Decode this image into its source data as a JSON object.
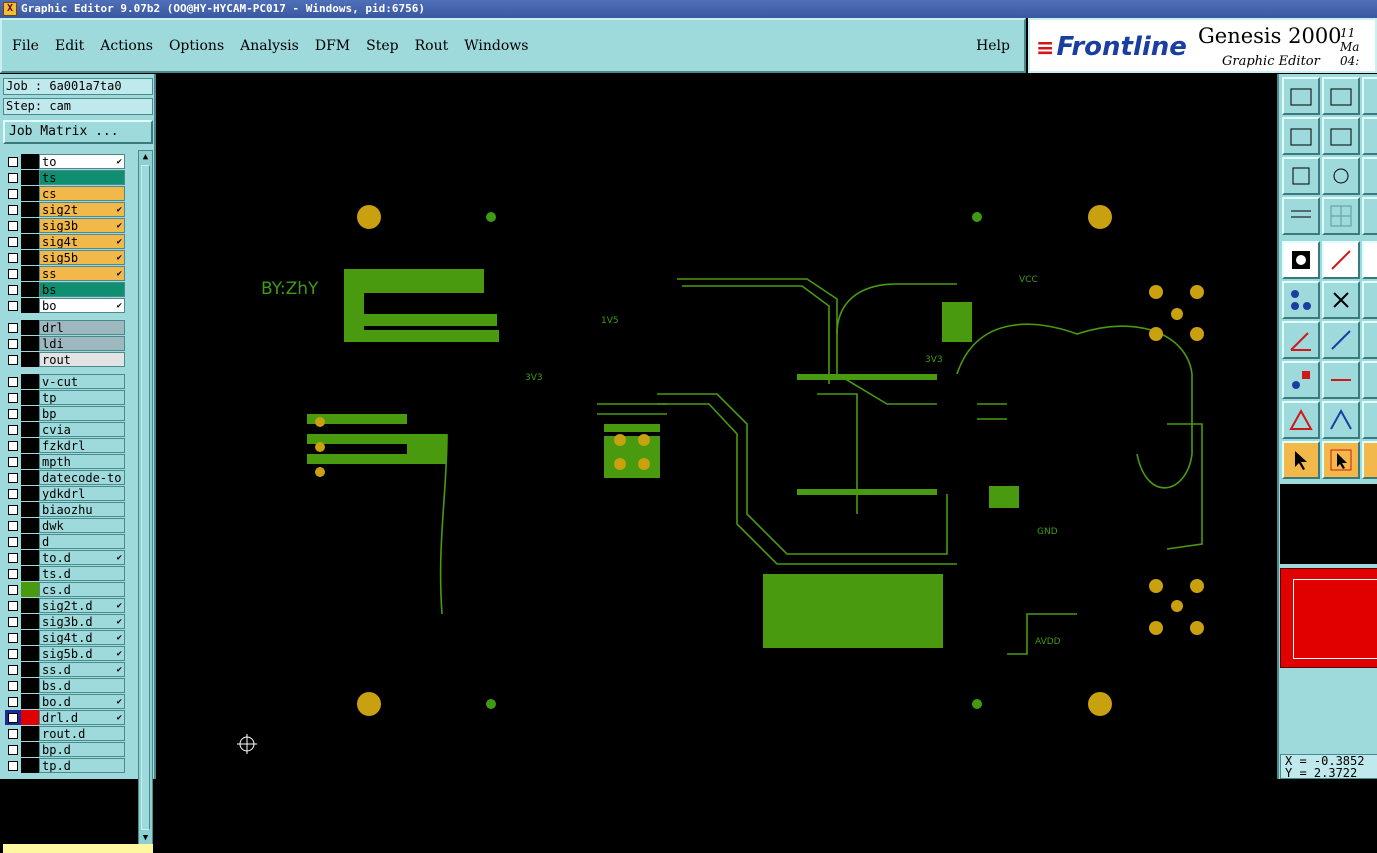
{
  "window": {
    "title": "Graphic Editor 9.07b2 (OO@HY-HYCAM-PC017 - Windows, pid:6756)"
  },
  "menu": [
    "File",
    "Edit",
    "Actions",
    "Options",
    "Analysis",
    "DFM",
    "Step",
    "Rout",
    "Windows"
  ],
  "menu_help": "Help",
  "brand": {
    "logo": "Frontline",
    "product": "Genesis 2000",
    "subtitle": "Graphic Editor",
    "clock_line1": "11 Ma",
    "clock_line2": "04:"
  },
  "job": {
    "label": "Job : 6a001a7ta0",
    "step": "Step: cam",
    "matrix_button": "Job Matrix ..."
  },
  "layers": [
    {
      "name": "to",
      "color": "#ffffff",
      "tick": true
    },
    {
      "name": "ts",
      "color": "#0e8f70",
      "tick": false
    },
    {
      "name": "cs",
      "color": "#f3b84a",
      "tick": false
    },
    {
      "name": "sig2t",
      "color": "#f3b84a",
      "tick": true
    },
    {
      "name": "sig3b",
      "color": "#f3b84a",
      "tick": true
    },
    {
      "name": "sig4t",
      "color": "#f3b84a",
      "tick": true
    },
    {
      "name": "sig5b",
      "color": "#f3b84a",
      "tick": true
    },
    {
      "name": "ss",
      "color": "#f3b84a",
      "tick": true
    },
    {
      "name": "bs",
      "color": "#0e8f70",
      "tick": false
    },
    {
      "name": "bo",
      "color": "#ffffff",
      "tick": true
    },
    {
      "name": "drl",
      "color": "#9fb8bf",
      "tick": false
    },
    {
      "name": "ldi",
      "color": "#9fb8bf",
      "tick": false
    },
    {
      "name": "rout",
      "color": "#e3e3e3",
      "tick": false
    },
    {
      "name": "v-cut",
      "color": "#9ed9dc",
      "tick": false
    },
    {
      "name": "tp",
      "color": "#9ed9dc",
      "tick": false
    },
    {
      "name": "bp",
      "color": "#9ed9dc",
      "tick": false
    },
    {
      "name": "cvia",
      "color": "#9ed9dc",
      "tick": false
    },
    {
      "name": "fzkdrl",
      "color": "#9ed9dc",
      "tick": false
    },
    {
      "name": "mpth",
      "color": "#9ed9dc",
      "tick": false
    },
    {
      "name": "datecode-to",
      "color": "#9ed9dc",
      "tick": false
    },
    {
      "name": "ydkdrl",
      "color": "#9ed9dc",
      "tick": false
    },
    {
      "name": "biaozhu",
      "color": "#9ed9dc",
      "tick": false
    },
    {
      "name": "dwk",
      "color": "#9ed9dc",
      "tick": false
    },
    {
      "name": "d",
      "color": "#9ed9dc",
      "tick": false
    },
    {
      "name": "to.d",
      "color": "#9ed9dc",
      "tick": true
    },
    {
      "name": "ts.d",
      "color": "#9ed9dc",
      "tick": false
    },
    {
      "name": "cs.d",
      "color": "#9ed9dc",
      "tick": false
    },
    {
      "name": "sig2t.d",
      "color": "#9ed9dc",
      "tick": true
    },
    {
      "name": "sig3b.d",
      "color": "#9ed9dc",
      "tick": true
    },
    {
      "name": "sig4t.d",
      "color": "#9ed9dc",
      "tick": true
    },
    {
      "name": "sig5b.d",
      "color": "#9ed9dc",
      "tick": true
    },
    {
      "name": "ss.d",
      "color": "#9ed9dc",
      "tick": true
    },
    {
      "name": "bs.d",
      "color": "#9ed9dc",
      "tick": false
    },
    {
      "name": "bo.d",
      "color": "#9ed9dc",
      "tick": true
    },
    {
      "name": "drl.d",
      "color": "#9ed9dc",
      "tick": true
    },
    {
      "name": "rout.d",
      "color": "#9ed9dc",
      "tick": false
    },
    {
      "name": "bp.d",
      "color": "#9ed9dc",
      "tick": false
    },
    {
      "name": "tp.d",
      "color": "#9ed9dc",
      "tick": false
    }
  ],
  "board_labels": {
    "author": "BY:ZhY",
    "vcc": "VCC",
    "v1": "1V5",
    "v2": "3V3",
    "v3": "3V3",
    "gnd": "GND",
    "avdd": "AVDD"
  },
  "coords": {
    "x": "X = -0.3852",
    "y": "Y = 2.3722"
  },
  "colors": {
    "trace": "#4a9a10",
    "pad": "#c8a010",
    "panel": "#9ed9dc",
    "highlight_layer": "#e00000"
  }
}
